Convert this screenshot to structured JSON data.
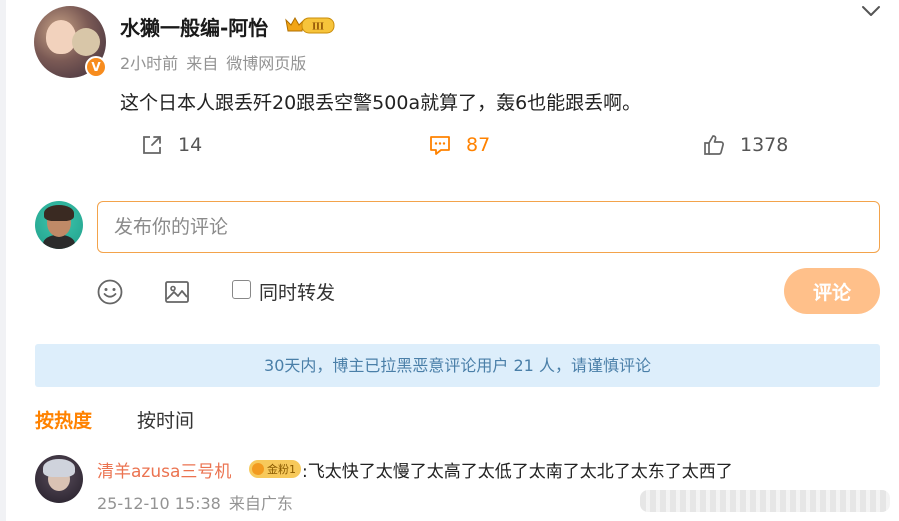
{
  "post": {
    "username": "水獭一般编-阿怡",
    "vip_level": "III",
    "time": "2小时前",
    "source_prefix": "来自",
    "source": "微博网页版",
    "verify_mark": "V",
    "text": "这个日本人跟丢歼20跟丢空警500a就算了，轰6也能跟丢啊。",
    "repost_count": "14",
    "comment_count": "87",
    "like_count": "1378"
  },
  "composer": {
    "placeholder": "发布你的评论",
    "repost_label": "同时转发",
    "submit_label": "评论"
  },
  "notice": "30天内，博主已拉黑恶意评论用户 21 人，请谨慎评论",
  "sort_tabs": [
    "按热度",
    "按时间"
  ],
  "comments": [
    {
      "user": "清羊azusa三号机",
      "badge": "金粉1",
      "text": ":飞太快了太慢了太高了太低了太南了太北了太东了太西了",
      "date": "25-12-10 15:38",
      "location": "来自广东"
    }
  ],
  "colors": {
    "accent": "#ff8200",
    "submit_disabled": "#ffc08a",
    "notice_bg": "#ddeefb",
    "notice_text": "#4a7fa8",
    "username_link": "#eb7350"
  },
  "icons": {
    "expand": "chevron-down-icon",
    "repost": "repost-icon",
    "comment": "comment-icon",
    "like": "thumbs-up-icon",
    "emoji": "emoji-icon",
    "image": "image-icon"
  }
}
